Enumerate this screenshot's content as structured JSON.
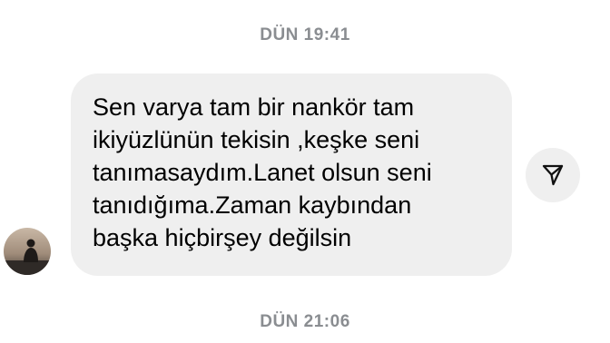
{
  "chat": {
    "timestamp_top": "DÜN 19:41",
    "timestamp_bottom": "DÜN 21:06",
    "message": {
      "text": "Sen varya tam bir nankör tam\nikiyüzlünün tekisin ,keşke seni\ntanımasaydım.Lanet olsun seni\ntanıdığıma.Zaman kaybından\nbaşka hiçbirşey değilsin"
    },
    "icons": {
      "avatar": "avatar-photo",
      "share": "share-arrow-icon"
    },
    "colors": {
      "bubble": "#efefef",
      "timestamp": "#8a8d91",
      "text": "#000000"
    }
  }
}
